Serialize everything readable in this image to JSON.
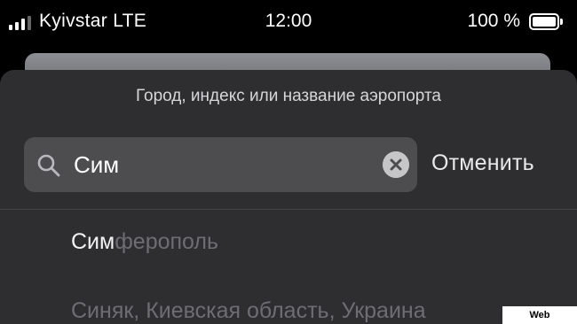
{
  "status_bar": {
    "carrier": "Kyivstar LTE",
    "time": "12:00",
    "battery": "100 %",
    "battery_level": 1.0
  },
  "search": {
    "prompt": "Город, индекс или название аэропорта",
    "query": "Сим",
    "cancel_label": "Отменить"
  },
  "results": [
    {
      "match": "Сим",
      "rest": "ферополь"
    },
    {
      "match": "",
      "rest": "Синяк, Киевская область, Украина"
    }
  ],
  "watermark": "Web Screenshot",
  "colors": {
    "sheet": "#2e2e31",
    "field": "#4d4d50",
    "dim_text": "#6e6e72"
  }
}
